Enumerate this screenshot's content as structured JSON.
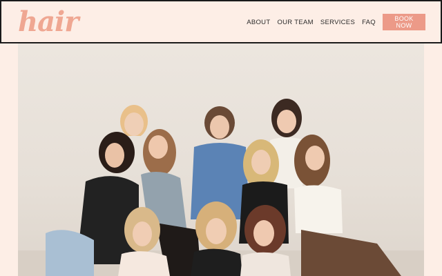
{
  "header": {
    "logo": "hair",
    "nav": [
      "ABOUT",
      "OUR TEAM",
      "SERVICES",
      "FAQ"
    ],
    "book_label": "BOOK NOW"
  },
  "colors": {
    "background": "#fdeee6",
    "accent": "#ec9a88",
    "logo": "#efa792",
    "border": "#1a1a1a"
  }
}
